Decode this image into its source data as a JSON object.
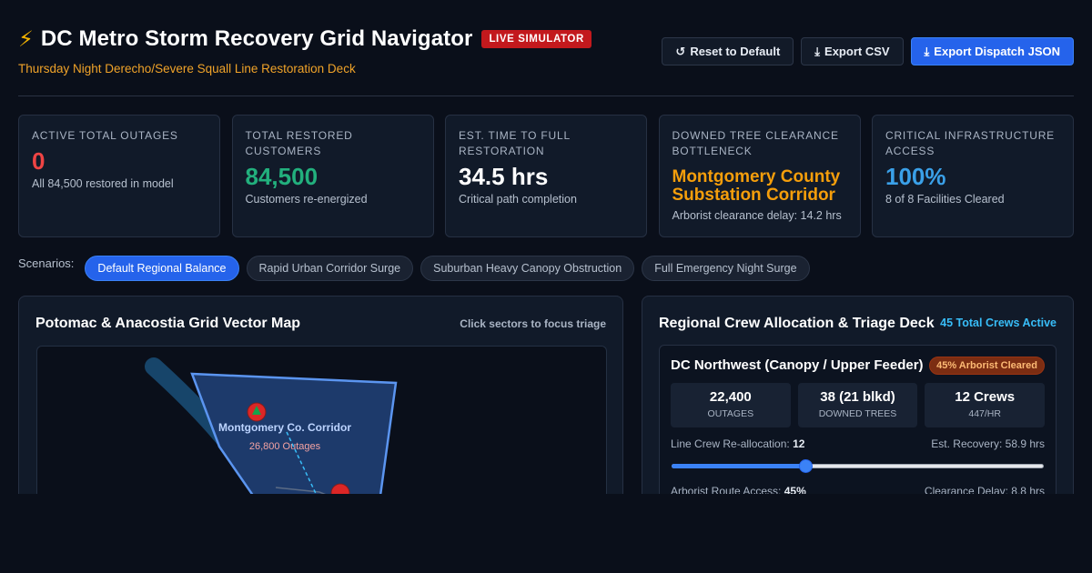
{
  "header": {
    "icon": "lightning-bolt-icon",
    "bolt_glyph": "⚡",
    "title": "DC Metro Storm Recovery Grid Navigator",
    "live_badge": "LIVE SIMULATOR",
    "subtitle": "Thursday Night Derecho/Severe Squall Line Restoration Deck"
  },
  "actions": {
    "reset": {
      "icon": "↺",
      "label": "Reset to Default"
    },
    "export_csv": {
      "icon": "⤓",
      "label": "Export CSV"
    },
    "export_json": {
      "icon": "⤓",
      "label": "Export Dispatch JSON"
    }
  },
  "kpis": [
    {
      "label": "Active Total Outages",
      "value": "0",
      "sub": "All 84,500 restored in model",
      "color": "#ef4444"
    },
    {
      "label": "Total Restored Customers",
      "value": "84,500",
      "sub": "Customers re-energized",
      "color": "#22b07d"
    },
    {
      "label": "Est. Time to Full Restoration",
      "value": "34.5 hrs",
      "sub": "Critical path completion",
      "color": "#ffffff"
    },
    {
      "label": "Downed Tree Clearance Bottleneck",
      "value": "Montgomery County Substation Corridor",
      "sub": "Arborist clearance delay: 14.2 hrs",
      "color": "#f59e0b"
    },
    {
      "label": "Critical Infrastructure Access",
      "value": "100%",
      "sub": "8 of 8 Facilities Cleared",
      "color": "#3aa0e8"
    }
  ],
  "scenarios": {
    "label": "Scenarios:",
    "items": [
      {
        "label": "Default Regional Balance",
        "active": true
      },
      {
        "label": "Rapid Urban Corridor Surge",
        "active": false
      },
      {
        "label": "Suburban Heavy Canopy Obstruction",
        "active": false
      },
      {
        "label": "Full Emergency Night Surge",
        "active": false
      }
    ]
  },
  "map_panel": {
    "title": "Potomac & Anacostia Grid Vector Map",
    "hint": "Click sectors to focus triage",
    "sector_label": "Montgomery Co. Corridor",
    "sector_outages": "26,800 Outages",
    "marker_icon": "tree-icon"
  },
  "crew_panel": {
    "title": "Regional Crew Allocation & Triage Deck",
    "crews_active": "45 Total Crews Active",
    "sector": {
      "name": "DC Northwest (Canopy / Upper Feeder)",
      "badge": "45% Arborist Cleared",
      "stats": [
        {
          "value": "22,400",
          "label": "Outages"
        },
        {
          "value": "38 (21 blkd)",
          "label": "Downed Trees"
        },
        {
          "value": "12 Crews",
          "label": "447/hr"
        }
      ],
      "line_crew": {
        "label": "Line Crew Re-allocation:",
        "value": "12",
        "recovery": "Est. Recovery: 58.9 hrs",
        "slider_fraction": 0.36
      },
      "arborist": {
        "label": "Arborist Route Access:",
        "value": "45%",
        "delay": "Clearance Delay: 8.8 hrs"
      }
    }
  }
}
